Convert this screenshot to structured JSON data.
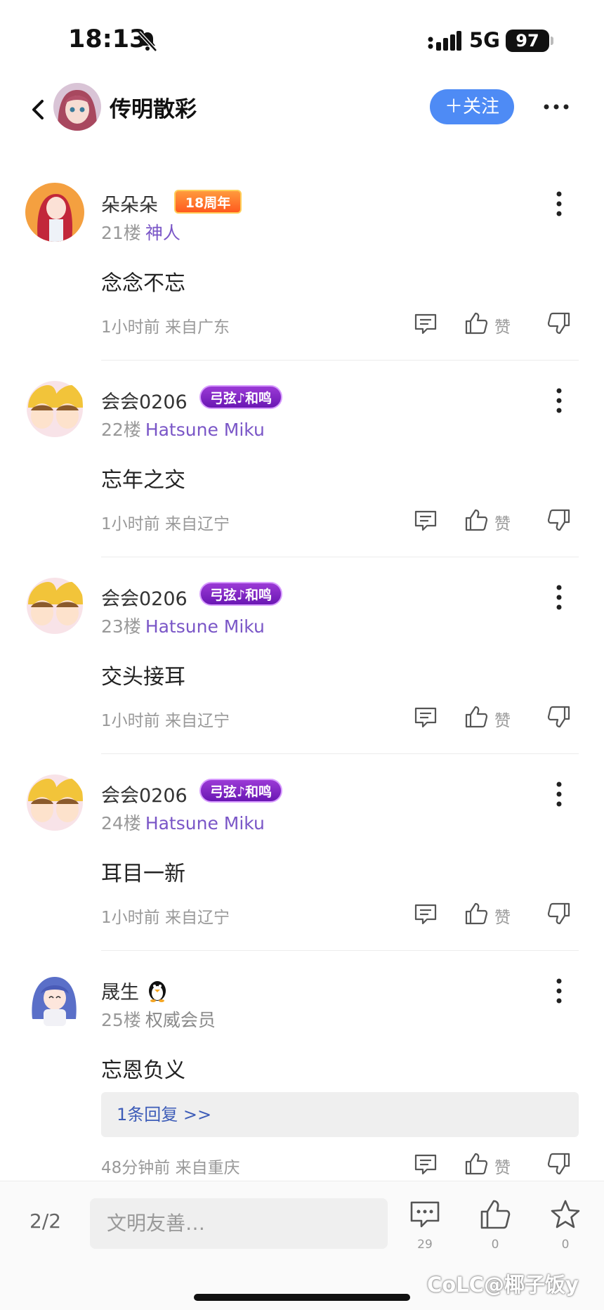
{
  "status": {
    "time": "18:13",
    "network": "5G",
    "battery": "97"
  },
  "header": {
    "title": "传明散彩",
    "follow_label": "＋关注"
  },
  "comments": [
    {
      "user": "朵朵朵",
      "badge": "18周年",
      "floor": "21楼",
      "role": "神人",
      "text": "念念不忘",
      "meta": "1小时前 来自广东",
      "like_label": "赞"
    },
    {
      "user": "会会0206",
      "badge": "弓弦♪和鸣",
      "floor": "22楼",
      "role": "Hatsune Miku",
      "text": "忘年之交",
      "meta": "1小时前 来自辽宁",
      "like_label": "赞"
    },
    {
      "user": "会会0206",
      "badge": "弓弦♪和鸣",
      "floor": "23楼",
      "role": "Hatsune Miku",
      "text": "交头接耳",
      "meta": "1小时前 来自辽宁",
      "like_label": "赞"
    },
    {
      "user": "会会0206",
      "badge": "弓弦♪和鸣",
      "floor": "24楼",
      "role": "Hatsune Miku",
      "text": "耳目一新",
      "meta": "1小时前 来自辽宁",
      "like_label": "赞"
    },
    {
      "user": "晟生",
      "floor": "25楼",
      "role": "权威会员",
      "text": "忘恩负义",
      "reply_label": "1条回复 >>",
      "meta": "48分钟前 来自重庆",
      "like_label": "赞"
    }
  ],
  "bottom": {
    "page": "2/2",
    "input_placeholder": "文明友善…",
    "comment_count": "29",
    "like_count": "0",
    "fav_count": "0",
    "watermark": "CoLC@椰子饭y"
  },
  "colors": {
    "accent": "#4e8bf5",
    "role_purple": "#7a56c7",
    "link_blue": "#3d5cb8"
  },
  "icons": [
    "bell-slash-icon",
    "signal-icon",
    "back-icon",
    "more-icon",
    "comment-icon",
    "thumbs-up-icon",
    "thumbs-down-icon",
    "star-icon",
    "penguin-icon"
  ]
}
